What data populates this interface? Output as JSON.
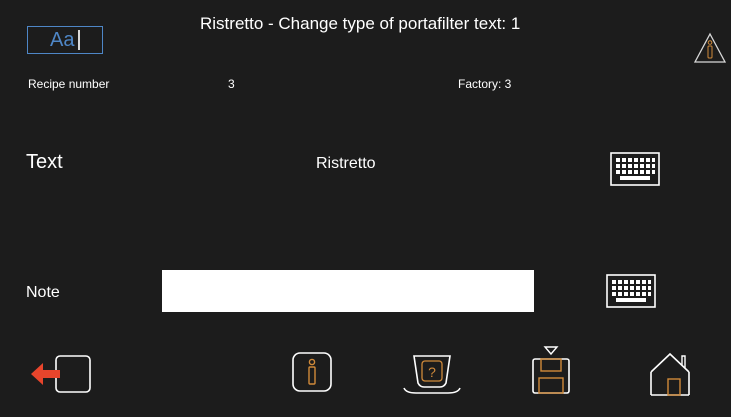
{
  "header": {
    "title": "Ristretto - Change type of portafilter text: 1",
    "font_button_label": "Aa",
    "warning_icon": "warning-info-icon"
  },
  "recipe": {
    "number_label": "Recipe number",
    "number_value": "3",
    "factory_label": "Factory: 3"
  },
  "text_field": {
    "label": "Text",
    "value": "Ristretto",
    "keyboard_icon": "keyboard-icon"
  },
  "note_field": {
    "label": "Note",
    "value": "",
    "keyboard_icon": "keyboard-icon"
  },
  "bottom_bar": {
    "icons": [
      "back-arrow-icon",
      "info-icon",
      "cup-help-icon",
      "save-icon",
      "home-icon"
    ]
  },
  "colors": {
    "background": "#1c1c1c",
    "accent_blue": "#4e86c6",
    "accent_orange": "#d08a3a",
    "back_arrow_red": "#e8452c"
  }
}
